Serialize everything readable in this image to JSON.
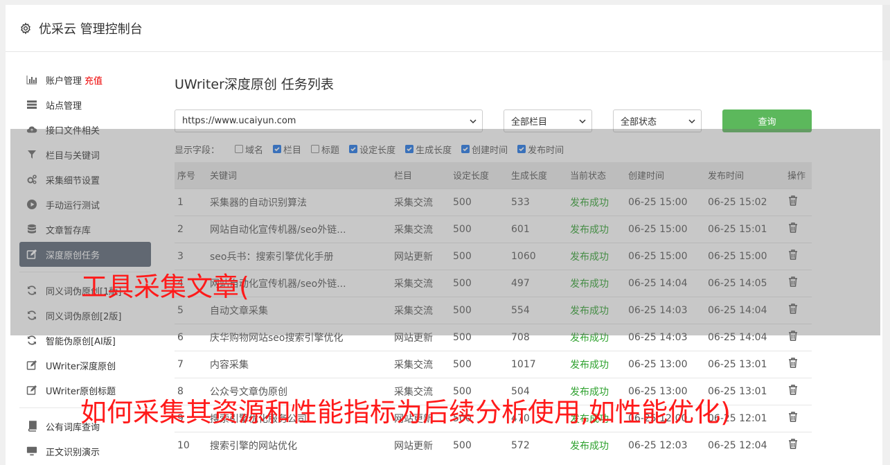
{
  "header": {
    "title": "优采云 管理控制台"
  },
  "sidebar": {
    "items": [
      {
        "label": "账户管理",
        "icon": "bar-chart-icon",
        "extra": "充值"
      },
      {
        "label": "站点管理",
        "icon": "server-icon"
      },
      {
        "label": "接口文件相关",
        "icon": "cloud-upload-icon"
      },
      {
        "label": "栏目与关键词",
        "icon": "filter-icon"
      },
      {
        "label": "采集细节设置",
        "icon": "cogs-icon"
      },
      {
        "label": "手动运行测试",
        "icon": "play-circle-icon"
      },
      {
        "label": "文章暂存库",
        "icon": "database-icon"
      },
      {
        "label": "深度原创任务",
        "icon": "edit-icon",
        "active": true
      },
      {
        "label": "同义词伪原创[1版]",
        "icon": "refresh-icon"
      },
      {
        "label": "同义词伪原创[2版]",
        "icon": "refresh-icon"
      },
      {
        "label": "智能伪原创[AI版]",
        "icon": "refresh-icon"
      },
      {
        "label": "UWriter深度原创",
        "icon": "edit-icon"
      },
      {
        "label": "UWriter原创标题",
        "icon": "edit-icon"
      },
      {
        "label": "公有词库查询",
        "icon": "book-icon"
      },
      {
        "label": "正文识别演示",
        "icon": "monitor-icon"
      }
    ]
  },
  "main": {
    "title": "UWriter深度原创 任务列表",
    "site_select": "https://www.ucaiyun.com",
    "column_select": "全部栏目",
    "status_select": "全部状态",
    "query_button": "查询",
    "fields_label": "显示字段：",
    "fields": [
      {
        "label": "域名",
        "checked": false
      },
      {
        "label": "栏目",
        "checked": true
      },
      {
        "label": "标题",
        "checked": false
      },
      {
        "label": "设定长度",
        "checked": true
      },
      {
        "label": "生成长度",
        "checked": true
      },
      {
        "label": "创建时间",
        "checked": true
      },
      {
        "label": "发布时间",
        "checked": true
      }
    ]
  },
  "table": {
    "headers": [
      "序号",
      "关键词",
      "栏目",
      "设定长度",
      "生成长度",
      "当前状态",
      "创建时间",
      "发布时间",
      "操作"
    ],
    "rows": [
      [
        "1",
        "采集器的自动识别算法",
        "采集交流",
        "500",
        "533",
        "发布成功",
        "06-25 15:00",
        "06-25 15:02"
      ],
      [
        "2",
        "网站自动化宣传机器/seo外链...",
        "采集交流",
        "500",
        "601",
        "发布成功",
        "06-25 15:00",
        "06-25 15:01"
      ],
      [
        "3",
        "seo兵书：搜索引擎优化手册",
        "网站更新",
        "500",
        "1060",
        "发布成功",
        "06-25 15:00",
        "06-25 15:00"
      ],
      [
        "4",
        "网站自动化宣传机器/seo外链...",
        "采集交流",
        "500",
        "497",
        "发布成功",
        "06-25 14:04",
        "06-25 14:05"
      ],
      [
        "5",
        "自动文章采集",
        "采集交流",
        "500",
        "554",
        "发布成功",
        "06-25 14:03",
        "06-25 14:04"
      ],
      [
        "6",
        "庆华购物网站seo搜索引擎优化",
        "网站更新",
        "500",
        "708",
        "发布成功",
        "06-25 14:03",
        "06-25 14:04"
      ],
      [
        "7",
        "内容采集",
        "采集交流",
        "500",
        "1017",
        "发布成功",
        "06-25 13:00",
        "06-25 13:01"
      ],
      [
        "8",
        "公众号文章伪原创",
        "采集交流",
        "500",
        "504",
        "发布成功",
        "06-25 13:00",
        "06-25 13:01"
      ],
      [
        "9",
        "搜索引擎优化服务公司",
        "网站更新",
        "500",
        "470",
        "发布成功",
        "06-25 12:00",
        "06-25 12:01"
      ],
      [
        "10",
        "搜索引擎的网站优化",
        "网站更新",
        "500",
        "572",
        "发布成功",
        "06-25 12:03",
        "06-25 12:04"
      ]
    ]
  },
  "watermarks": {
    "line1": "工具采集文章(",
    "line2": "如何采集其资源和性能指标为后续分析使用,如性能优化)"
  },
  "colors": {
    "active_bg": "#5a6474",
    "query_btn": "#5cb85c",
    "success": "#2ea12e",
    "recharge": "#ee0000",
    "watermark": "#ff1a1a"
  }
}
